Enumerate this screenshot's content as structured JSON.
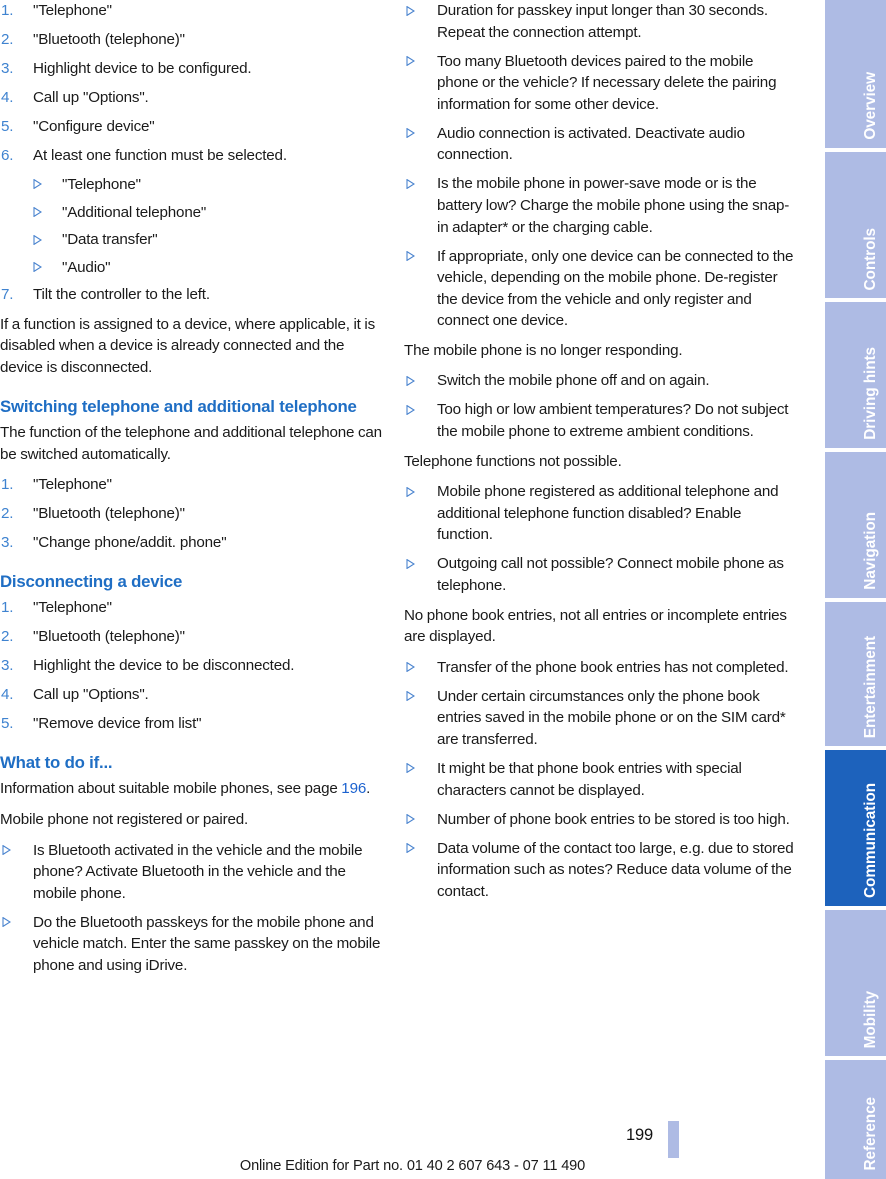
{
  "document": {
    "page_number": "199",
    "footer_note": "Online Edition for Part no. 01 40 2 607 643 - 07 11 490"
  },
  "tab_rail": {
    "tabs": [
      {
        "label": "Overview",
        "active": false
      },
      {
        "label": "Controls",
        "active": false
      },
      {
        "label": "Driving hints",
        "active": false
      },
      {
        "label": "Navigation",
        "active": false
      },
      {
        "label": "Entertainment",
        "active": false
      },
      {
        "label": "Communication",
        "active": true
      },
      {
        "label": "Mobility",
        "active": false
      },
      {
        "label": "Reference",
        "active": false
      }
    ]
  },
  "left_column": {
    "configure_steps": [
      {
        "num": "1.",
        "text": "\"Telephone\""
      },
      {
        "num": "2.",
        "text": "\"Bluetooth (telephone)\""
      },
      {
        "num": "3.",
        "text": "Highlight device to be configured."
      },
      {
        "num": "4.",
        "text": "Call up \"Options\"."
      },
      {
        "num": "5.",
        "text": "\"Configure device\""
      },
      {
        "num": "6.",
        "text": "At least one function must be selected."
      },
      {
        "num": "7.",
        "text": "Tilt the controller to the left."
      }
    ],
    "configure_substeps": [
      "\"Telephone\"",
      "\"Additional telephone\"",
      "\"Data transfer\"",
      "\"Audio\""
    ],
    "note_paragraph": "If a function is assigned to a device, where applicable, it is disabled when a device is already connected and the device is disconnected.",
    "switching_heading": "Switching telephone and additional telephone",
    "switching_intro": "The function of the telephone and additional telephone can be switched automatically.",
    "switching_steps": [
      {
        "num": "1.",
        "text": "\"Telephone\""
      },
      {
        "num": "2.",
        "text": "\"Bluetooth (telephone)\""
      },
      {
        "num": "3.",
        "text": "\"Change phone/addit. phone\""
      }
    ],
    "disconnecting_heading": "Disconnecting a device",
    "disconnecting_steps": [
      {
        "num": "1.",
        "text": "\"Telephone\""
      },
      {
        "num": "2.",
        "text": "\"Bluetooth (telephone)\""
      },
      {
        "num": "3.",
        "text": "Highlight the device to be disconnected."
      },
      {
        "num": "4.",
        "text": "Call up \"Options\"."
      },
      {
        "num": "5.",
        "text": "\"Remove device from list\""
      }
    ],
    "what_to_do_heading": "What to do if...",
    "what_to_do_intro_prefix": "Information about suitable mobile phones, see page ",
    "what_to_do_intro_page": "196",
    "what_to_do_intro_suffix": ".",
    "not_registered_lead": "Mobile phone not registered or paired.",
    "not_registered_items": [
      "Is Bluetooth activated in the vehicle and the mobile phone? Activate Bluetooth in the vehicle and the mobile phone.",
      "Do the Bluetooth passkeys for the mobile phone and vehicle match. Enter the same passkey on the mobile phone and using iDrive."
    ]
  },
  "right_column": {
    "not_registered_items_cont": [
      "Duration for passkey input longer than 30 seconds. Repeat the connection attempt.",
      "Too many Bluetooth devices paired to the mobile phone or the vehicle? If necessary delete the pairing information for some other device.",
      "Audio connection is activated. Deactivate audio connection.",
      "Is the mobile phone in power-save mode or is the battery low? Charge the mobile phone using the snap-in adapter* or the charging cable.",
      "If appropriate, only one device can be connected to the vehicle, depending on the mobile phone. De-register the device from the vehicle and only register and connect one device."
    ],
    "not_responding_lead": "The mobile phone is no longer responding.",
    "not_responding_items": [
      "Switch the mobile phone off and on again.",
      "Too high or low ambient temperatures? Do not subject the mobile phone to extreme ambient conditions."
    ],
    "functions_not_possible_lead": "Telephone functions not possible.",
    "functions_not_possible_items": [
      "Mobile phone registered as additional telephone and additional telephone function disabled? Enable function.",
      "Outgoing call not possible? Connect mobile phone as telephone."
    ],
    "phone_book_lead": "No phone book entries, not all entries or incomplete entries are displayed.",
    "phone_book_items": [
      "Transfer of the phone book entries has not completed.",
      "Under certain circumstances only the phone book entries saved in the mobile phone or on the SIM card* are transferred.",
      "It might be that phone book entries with special characters cannot be displayed.",
      "Number of phone book entries to be stored is too high.",
      "Data volume of the contact too large, e.g. due to stored information such as notes? Reduce data volume of the contact."
    ]
  }
}
